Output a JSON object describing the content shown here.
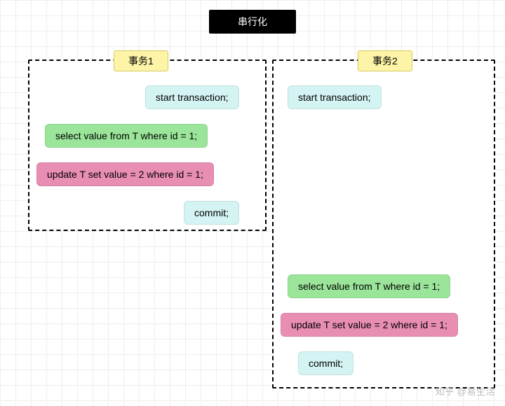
{
  "title": "串行化",
  "txn1": {
    "label": "事务1",
    "start": "start transaction;",
    "select": "select value from T where id = 1;",
    "update": "update T set value = 2 where id = 1;",
    "commit": "commit;"
  },
  "txn2": {
    "label": "事务2",
    "start": "start transaction;",
    "select": "select value from T where id = 1;",
    "update": "update T set value = 2 where id = 1;",
    "commit": "commit;"
  },
  "watermark": "知乎 @易生活"
}
